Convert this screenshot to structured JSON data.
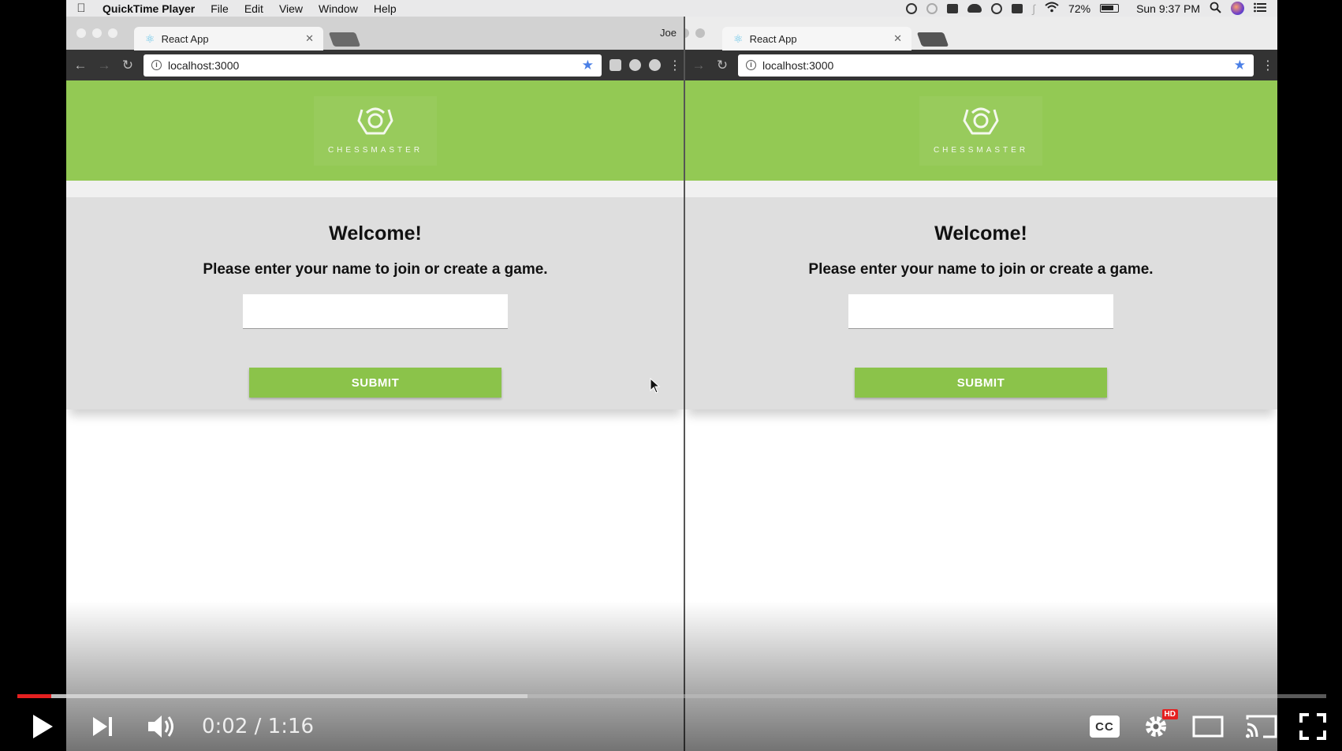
{
  "menubar": {
    "app_name": "QuickTime Player",
    "menus": [
      "File",
      "Edit",
      "View",
      "Window",
      "Help"
    ],
    "battery": "72%",
    "clock": "Sun 9:37 PM"
  },
  "left_window": {
    "tab_title": "React App",
    "profile_name": "Joe",
    "url": "localhost:3000"
  },
  "right_window": {
    "tab_title": "React App",
    "url": "localhost:3000"
  },
  "page": {
    "brand": "CHESSMASTER",
    "welcome": "Welcome!",
    "prompt": "Please enter your name to join or create a game.",
    "input_value": "",
    "submit_label": "SUBMIT"
  },
  "player": {
    "time": "0:02 / 1:16",
    "played_fraction": 0.026,
    "buffered_fraction": 0.39,
    "hd_badge": "HD",
    "cc_label": "CC",
    "accent_color": "#e52020"
  },
  "colors": {
    "hero_green": "#93c954",
    "button_green": "#8bc34a",
    "card_gray": "#dedede"
  }
}
